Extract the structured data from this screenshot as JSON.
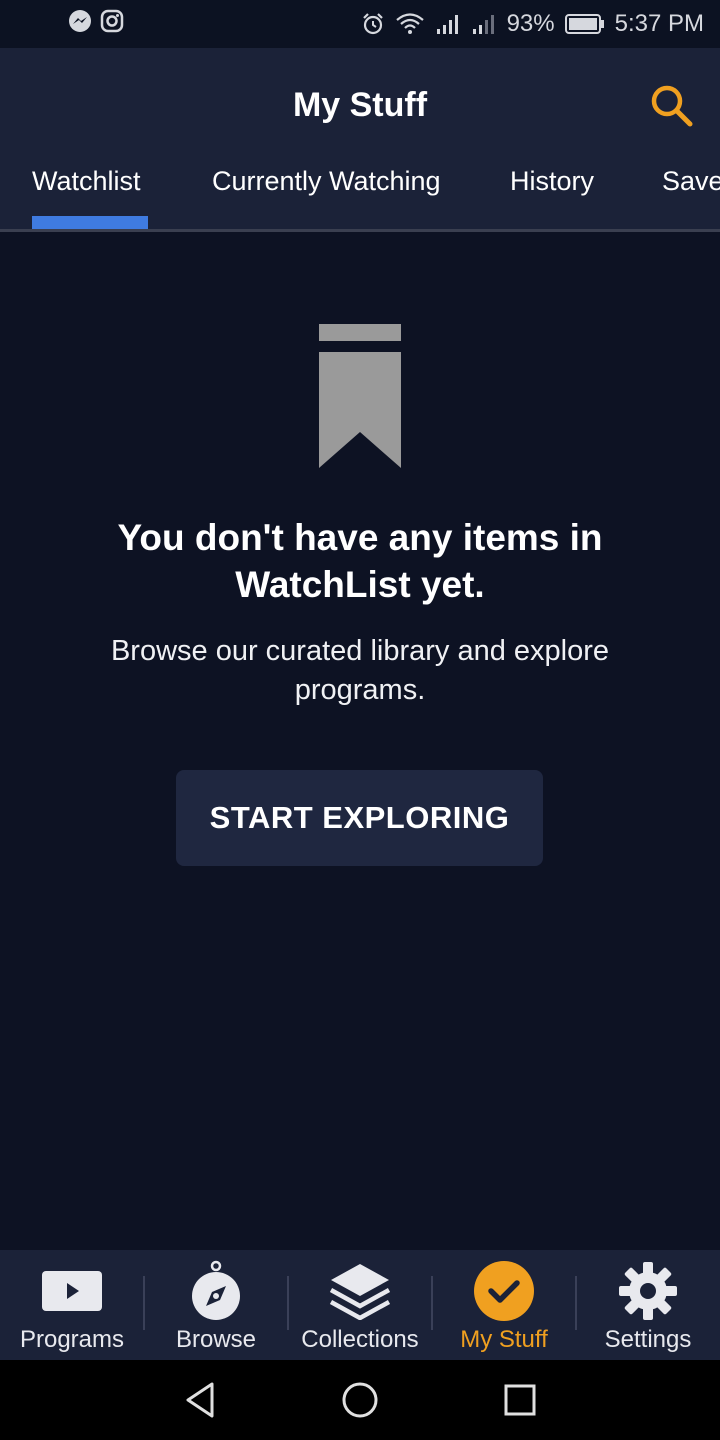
{
  "status_bar": {
    "battery": "93%",
    "time": "5:37 PM",
    "icons_left": [
      "messenger-icon",
      "instagram-icon"
    ],
    "icons_right": [
      "alarm-icon",
      "wifi-icon",
      "signal-icon",
      "signal-roaming-icon",
      "battery-icon"
    ]
  },
  "header": {
    "title": "My Stuff",
    "search_icon": "search-icon",
    "accent_color": "#f0a020"
  },
  "tabs": [
    {
      "label": "Watchlist",
      "active": true
    },
    {
      "label": "Currently Watching",
      "active": false
    },
    {
      "label": "History",
      "active": false
    },
    {
      "label": "Save",
      "active": false
    }
  ],
  "tab_indicator_color": "#3f7be0",
  "empty_state": {
    "icon": "bookmark-icon",
    "title": "You don't have any items in WatchList yet.",
    "subtitle": "Browse our curated library and explore programs.",
    "button_label": "START EXPLORING"
  },
  "bottom_nav": [
    {
      "label": "Programs",
      "icon": "play-icon",
      "active": false
    },
    {
      "label": "Browse",
      "icon": "compass-icon",
      "active": false
    },
    {
      "label": "Collections",
      "icon": "layers-icon",
      "active": false
    },
    {
      "label": "My Stuff",
      "icon": "check-circle-icon",
      "active": true
    },
    {
      "label": "Settings",
      "icon": "gear-icon",
      "active": false
    }
  ],
  "system_nav": [
    "back-icon",
    "home-icon",
    "recents-icon"
  ]
}
